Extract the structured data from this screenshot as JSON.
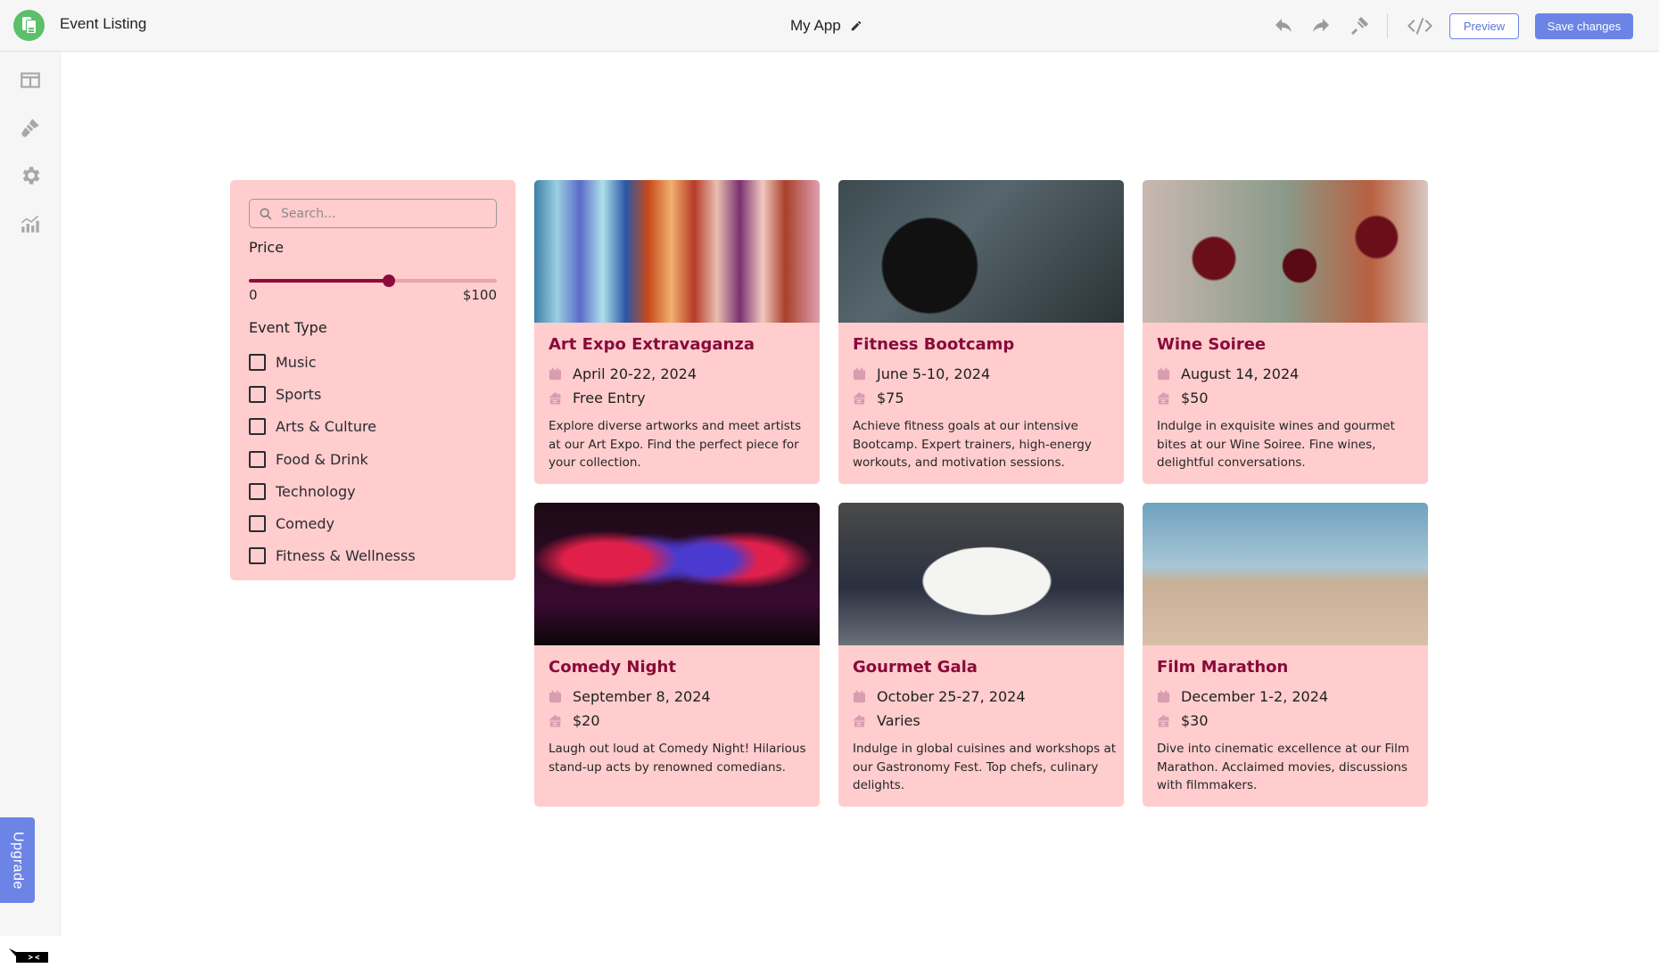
{
  "topbar": {
    "app_name": "Event Listing",
    "project_title": "My App",
    "preview_label": "Preview",
    "save_label": "Save changes"
  },
  "sidebar": {
    "items": [
      {
        "icon": "table-icon"
      },
      {
        "icon": "paintbrush-icon"
      },
      {
        "icon": "gear-icon"
      },
      {
        "icon": "analytics-icon"
      }
    ],
    "upgrade_label": "Upgrade"
  },
  "filters": {
    "search_placeholder": "Search...",
    "search_value": "",
    "price_label": "Price",
    "price_min_label": "0",
    "price_max_label": "$100",
    "price_value_fraction": 0.565,
    "event_type_label": "Event Type",
    "event_types": [
      {
        "label": "Music",
        "checked": false
      },
      {
        "label": "Sports",
        "checked": false
      },
      {
        "label": "Arts & Culture",
        "checked": false
      },
      {
        "label": "Food & Drink",
        "checked": false
      },
      {
        "label": "Technology",
        "checked": false
      },
      {
        "label": "Comedy",
        "checked": false
      },
      {
        "label": "Fitness & Wellnesss",
        "checked": false
      }
    ]
  },
  "events": [
    {
      "title": "Art Expo Extravaganza",
      "date": "April 20-22, 2024",
      "price": "Free Entry",
      "description": "Explore diverse artworks and meet artists at our Art Expo. Find the perfect piece for your collection.",
      "image": "art-installation-photo"
    },
    {
      "title": "Fitness Bootcamp",
      "date": "June 5-10, 2024",
      "price": "$75",
      "description": "Achieve fitness goals at our intensive Bootcamp. Expert trainers, high-energy workouts, and motivation sessions.",
      "image": "barbell-photo"
    },
    {
      "title": "Wine Soiree",
      "date": "August 14, 2024",
      "price": "$50",
      "description": "Indulge in exquisite wines and gourmet bites at our Wine Soiree. Fine wines, delightful conversations.",
      "image": "wine-glasses-photo"
    },
    {
      "title": "Comedy Night",
      "date": "September 8, 2024",
      "price": "$20",
      "description": "Laugh out loud at Comedy Night! Hilarious stand-up acts by renowned comedians.",
      "image": "stage-performer-photo"
    },
    {
      "title": "Gourmet Gala",
      "date": "October 25-27, 2024",
      "price": "Varies",
      "description": "Indulge in global cuisines and workshops at our Gastronomy Fest. Top chefs, culinary delights.",
      "image": "plated-food-photo"
    },
    {
      "title": "Film Marathon",
      "date": "December 1-2, 2024",
      "price": "$30",
      "description": "Dive into cinematic excellence at our Film Marathon. Acclaimed movies, discussions with filmmakers.",
      "image": "film-clapperboard-photo"
    }
  ],
  "colors": {
    "accent": "#6b84e6",
    "card_bg": "#ffcdcd",
    "title": "#8a0a3a",
    "slider": "#8c0a3c",
    "logo": "#5cbf6a"
  }
}
